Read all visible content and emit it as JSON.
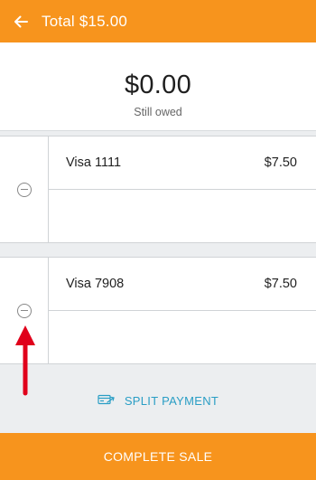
{
  "header": {
    "title": "Total $15.00",
    "back_icon": "arrow-left-icon"
  },
  "summary": {
    "amount": "$0.00",
    "caption": "Still owed"
  },
  "payments": [
    {
      "method": "Visa 1111",
      "amount": "$7.50",
      "remove_icon": "minus-circle-icon"
    },
    {
      "method": "Visa 7908",
      "amount": "$7.50",
      "remove_icon": "minus-circle-icon"
    }
  ],
  "split_payment": {
    "label": "SPLIT PAYMENT",
    "icon": "split-payment-icon"
  },
  "footer": {
    "complete_label": "COMPLETE SALE"
  },
  "colors": {
    "accent": "#f7941d",
    "link": "#2a9ec5",
    "annotation": "#e0001b"
  }
}
